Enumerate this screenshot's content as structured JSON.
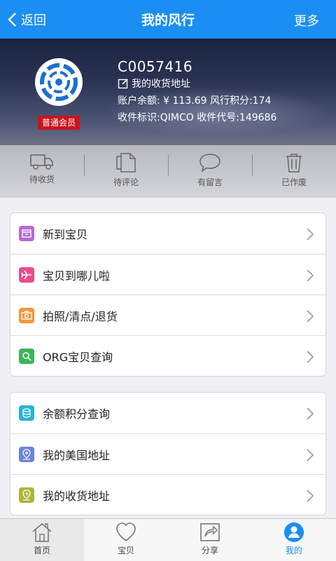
{
  "topbar": {
    "back_label": "返回",
    "title": "我的风行",
    "more_label": "更多"
  },
  "profile": {
    "user_id": "C0057416",
    "address_link": "我的收货地址",
    "balance_line": "账户余额: ¥ 113.69  风行积分:174",
    "code_line": "收件标识:QIMCO  收件代号:149686",
    "member_badge": "普通会员"
  },
  "status": [
    {
      "label": "待收货",
      "icon": "truck-icon"
    },
    {
      "label": "待评论",
      "icon": "document-icon"
    },
    {
      "label": "有留言",
      "icon": "speech-bubble-icon"
    },
    {
      "label": "已作废",
      "icon": "trash-icon"
    }
  ],
  "menu1": [
    {
      "label": "新到宝贝",
      "color": "#b66ad8",
      "icon": "box-icon"
    },
    {
      "label": "宝贝到哪儿啦",
      "color": "#ec4b8b",
      "icon": "airplane-icon"
    },
    {
      "label": "拍照/清点/退货",
      "color": "#f0983a",
      "icon": "camera-icon"
    },
    {
      "label": "ORG宝贝查询",
      "color": "#3cb55a",
      "icon": "search-icon"
    }
  ],
  "menu2": [
    {
      "label": "余额积分查询",
      "color": "#27b4d6",
      "icon": "coins-icon"
    },
    {
      "label": "我的美国地址",
      "color": "#6a82e0",
      "icon": "usa-location-icon"
    },
    {
      "label": "我的收货地址",
      "color": "#a9b63a",
      "icon": "china-location-icon"
    }
  ],
  "nav": [
    {
      "label": "首页",
      "icon": "home-icon"
    },
    {
      "label": "宝贝",
      "icon": "heart-icon"
    },
    {
      "label": "分享",
      "icon": "share-icon"
    },
    {
      "label": "我的",
      "icon": "user-icon"
    }
  ],
  "colors": {
    "accent": "#1b8ef3",
    "badge": "#c8161d"
  }
}
